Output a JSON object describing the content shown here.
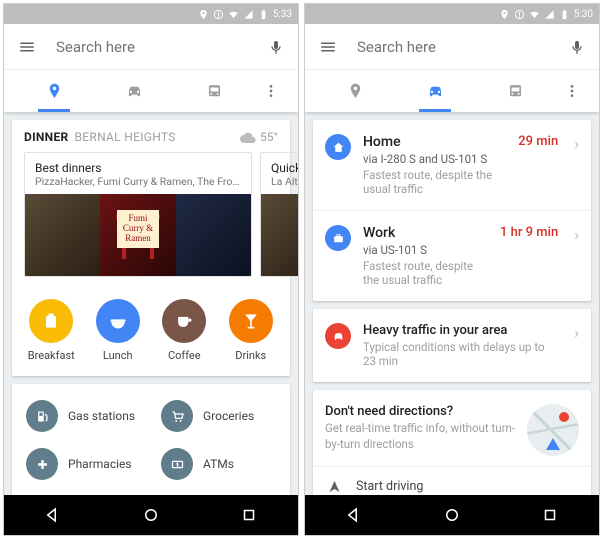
{
  "left": {
    "status_time": "5:33",
    "search_placeholder": "Search here",
    "section": {
      "title_bold": "DINNER",
      "title_light": "BERNAL HEIGHTS",
      "temp": "55°"
    },
    "dinner_main": {
      "title": "Best dinners",
      "sub": "PizzaHacker, Fumi Curry & Ramen, The Front...",
      "plaque1": "Fumi",
      "plaque2": "Curry &",
      "plaque3": "Ramen"
    },
    "dinner_peek": {
      "title": "Quick",
      "sub": "La Alt"
    },
    "cats": {
      "breakfast": "Breakfast",
      "lunch": "Lunch",
      "coffee": "Coffee",
      "drinks": "Drinks"
    },
    "svcs": {
      "gas": "Gas stations",
      "groceries": "Groceries",
      "pharmacies": "Pharmacies",
      "atms": "ATMs"
    }
  },
  "right": {
    "status_time": "5:30",
    "search_placeholder": "Search here",
    "dests": {
      "home": {
        "title": "Home",
        "via": "via I-280 S and US-101 S",
        "note": "Fastest route, despite the usual traffic",
        "time": "29 min"
      },
      "work": {
        "title": "Work",
        "via": "via US-101 S",
        "note": "Fastest route, despite the usual traffic",
        "time": "1 hr 9 min"
      }
    },
    "traffic": {
      "title": "Heavy traffic in your area",
      "sub": "Typical conditions with delays up to 23 min"
    },
    "promo": {
      "title": "Don't need directions?",
      "sub": "Get real-time traffic info, without turn-by-turn directions"
    },
    "start": "Start driving"
  }
}
